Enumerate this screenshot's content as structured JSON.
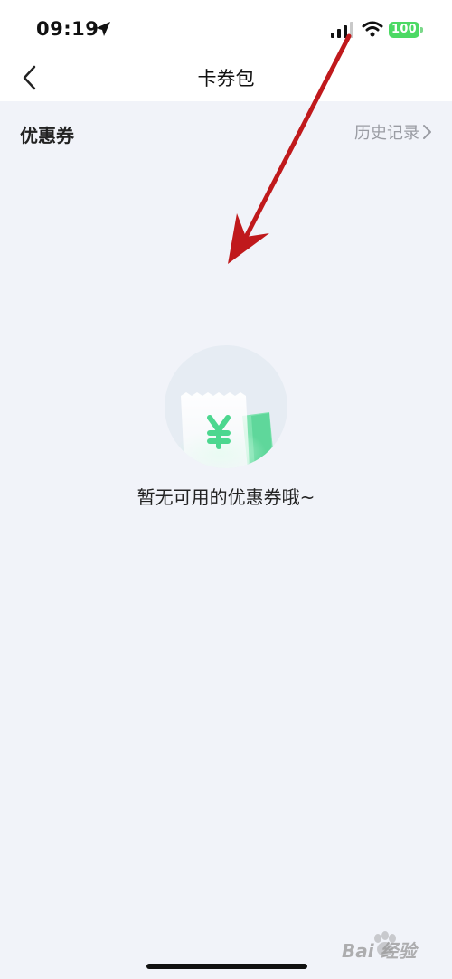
{
  "status_bar": {
    "time": "09:19",
    "battery": "100",
    "icons": [
      "location-arrow-icon",
      "signal-icon",
      "wifi-icon",
      "battery-icon"
    ]
  },
  "nav": {
    "title": "卡券包",
    "back_icon": "chevron-left-icon"
  },
  "section": {
    "title": "优惠券",
    "history_label": "历史记录",
    "history_icon": "chevron-right-icon"
  },
  "empty_state": {
    "icon": "coupon-yuan-icon",
    "message": "暂无可用的优惠券哦~"
  },
  "annotation": {
    "icon": "red-arrow",
    "color": "#c0191c"
  },
  "watermark": {
    "text": "Bai 经验"
  },
  "colors": {
    "page_bg": "#f1f3f9",
    "battery_green": "#4cd964",
    "accent_green": "#3ddc84"
  }
}
